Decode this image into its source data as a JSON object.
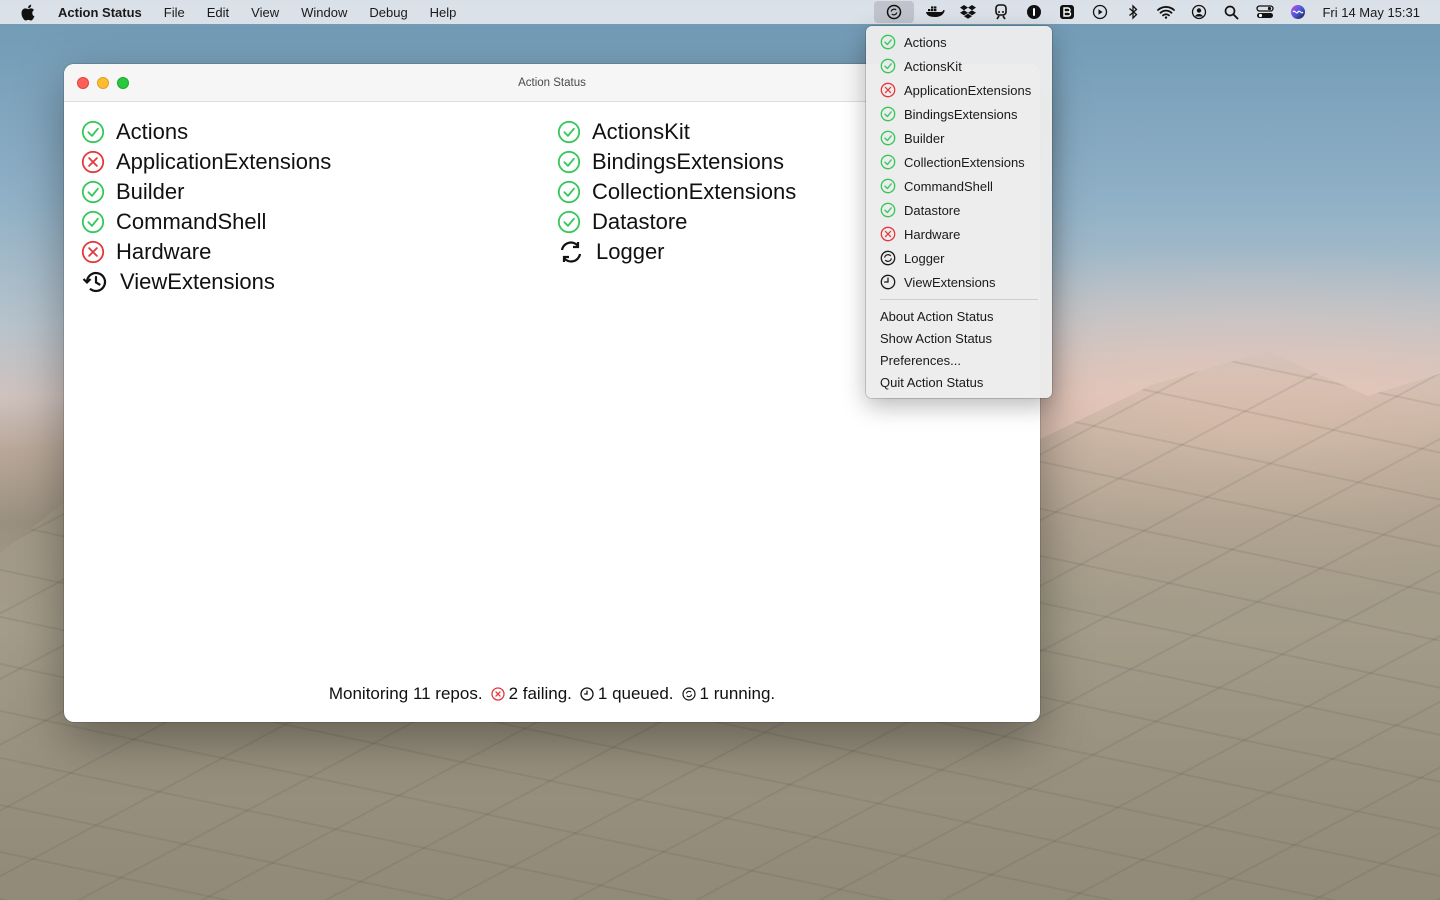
{
  "menubar": {
    "app_name": "Action Status",
    "menus": [
      "File",
      "Edit",
      "View",
      "Window",
      "Debug",
      "Help"
    ],
    "clock": "Fri 14 May  15:31"
  },
  "window": {
    "title": "Action Status",
    "repos": [
      {
        "name": "Actions",
        "status": "passing"
      },
      {
        "name": "ApplicationExtensions",
        "status": "failing"
      },
      {
        "name": "Builder",
        "status": "passing"
      },
      {
        "name": "CommandShell",
        "status": "passing"
      },
      {
        "name": "Hardware",
        "status": "failing"
      },
      {
        "name": "ViewExtensions",
        "status": "queued"
      },
      {
        "name": "ActionsKit",
        "status": "passing"
      },
      {
        "name": "BindingsExtensions",
        "status": "passing"
      },
      {
        "name": "CollectionExtensions",
        "status": "passing"
      },
      {
        "name": "Datastore",
        "status": "passing"
      },
      {
        "name": "Logger",
        "status": "running"
      }
    ],
    "footer": {
      "monitoring": "Monitoring 11 repos.",
      "failing": "2 failing.",
      "queued": "1 queued.",
      "running": "1 running."
    }
  },
  "dropdown": {
    "repos": [
      {
        "name": "Actions",
        "status": "passing"
      },
      {
        "name": "ActionsKit",
        "status": "passing"
      },
      {
        "name": "ApplicationExtensions",
        "status": "failing"
      },
      {
        "name": "BindingsExtensions",
        "status": "passing"
      },
      {
        "name": "Builder",
        "status": "passing"
      },
      {
        "name": "CollectionExtensions",
        "status": "passing"
      },
      {
        "name": "CommandShell",
        "status": "passing"
      },
      {
        "name": "Datastore",
        "status": "passing"
      },
      {
        "name": "Hardware",
        "status": "failing"
      },
      {
        "name": "Logger",
        "status": "running"
      },
      {
        "name": "ViewExtensions",
        "status": "queued"
      }
    ],
    "actions": [
      "About Action Status",
      "Show Action Status",
      "Preferences...",
      "Quit Action Status"
    ]
  },
  "colors": {
    "passing": "#34c759",
    "failing": "#e5383b",
    "neutral": "#1a1a1a"
  }
}
